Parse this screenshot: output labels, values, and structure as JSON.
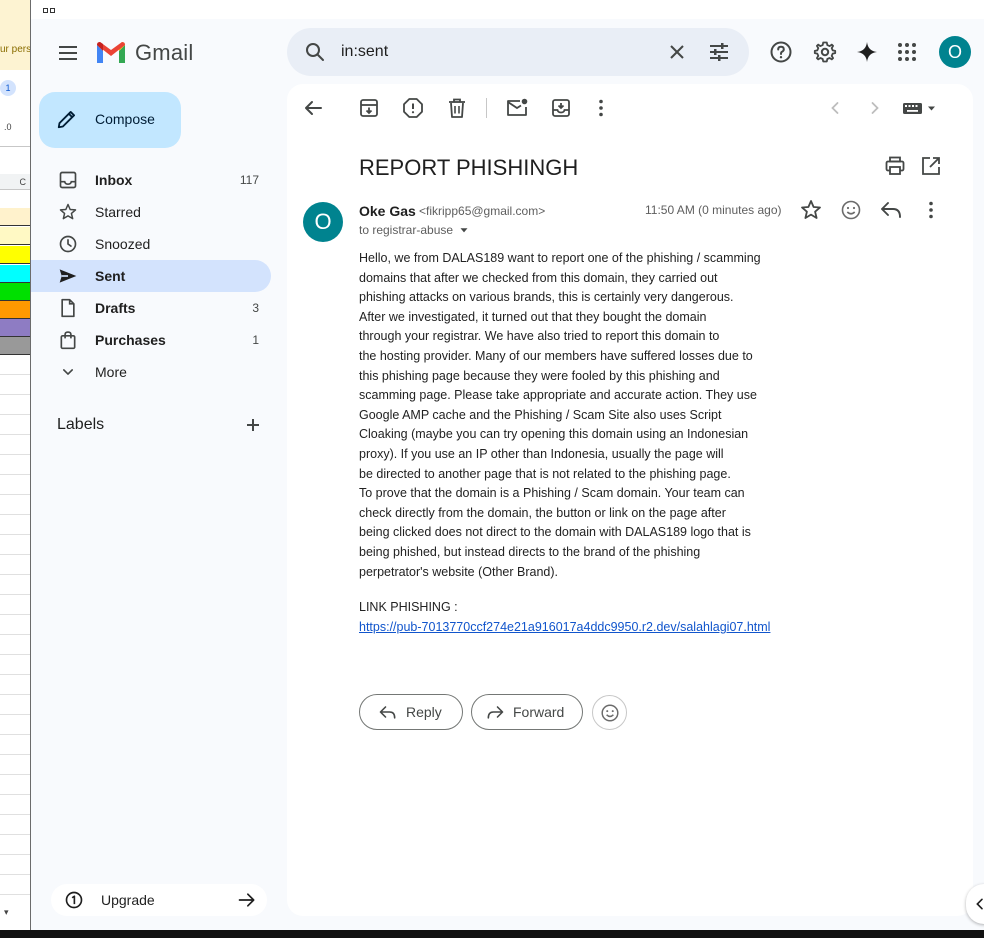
{
  "background_window": {
    "fragment_text": "ur pers",
    "badge": "1",
    "decimals": ".0",
    "column_header": "C"
  },
  "header": {
    "app_name": "Gmail",
    "search_value": "in:sent",
    "avatar_letter": "O"
  },
  "sidebar": {
    "compose_label": "Compose",
    "items": [
      {
        "label": "Inbox",
        "count": "117"
      },
      {
        "label": "Starred",
        "count": ""
      },
      {
        "label": "Snoozed",
        "count": ""
      },
      {
        "label": "Sent",
        "count": ""
      },
      {
        "label": "Drafts",
        "count": "3"
      },
      {
        "label": "Purchases",
        "count": "1"
      },
      {
        "label": "More",
        "count": ""
      }
    ],
    "labels_heading": "Labels",
    "upgrade_label": "Upgrade"
  },
  "email": {
    "subject": "REPORT PHISHINGH",
    "sender_initial": "O",
    "sender_name": "Oke Gas",
    "sender_email": "<fikripp65@gmail.com>",
    "to": "to registrar-abuse",
    "time": "11:50 AM (0 minutes ago)",
    "body_lines": [
      "Hello, we from DALAS189  want to report one of the phishing / scamming",
      "domains that after we checked from this domain, they carried out",
      "phishing attacks on various brands, this is certainly very dangerous.",
      "After we investigated, it turned out that they bought the domain",
      "through your registrar. We have also tried to report this domain to",
      "the hosting provider. Many of our members have suffered losses due to",
      "this phishing page because they were fooled by this phishing and",
      "scamming page. Please take appropriate and accurate action. They use",
      "Google AMP cache and the Phishing / Scam Site also uses Script",
      "Cloaking (maybe you can try opening this domain using an Indonesian",
      "proxy). If you use an IP other than Indonesia, usually the page will",
      "be directed to another page that is not related to the phishing page.",
      "To prove that the domain is a Phishing / Scam domain. Your team can",
      "check directly from the domain, the button or link on the page after",
      "being clicked does not direct to the domain with DALAS189 logo that is",
      "being phished, but instead directs to the brand of the phishing",
      "perpetrator's website (Other Brand)."
    ],
    "link_label": "LINK PHISHING :",
    "link_url": "https://pub-7013770ccf274e21a916017a4ddc9950.r2.dev/salahlagi07.html",
    "reply_label": "Reply",
    "forward_label": "Forward"
  },
  "colors": {
    "accent": "#0b57d0",
    "avatar": "#00838f",
    "compose_bg": "#c2e7ff",
    "active_nav": "#d3e3fd"
  }
}
